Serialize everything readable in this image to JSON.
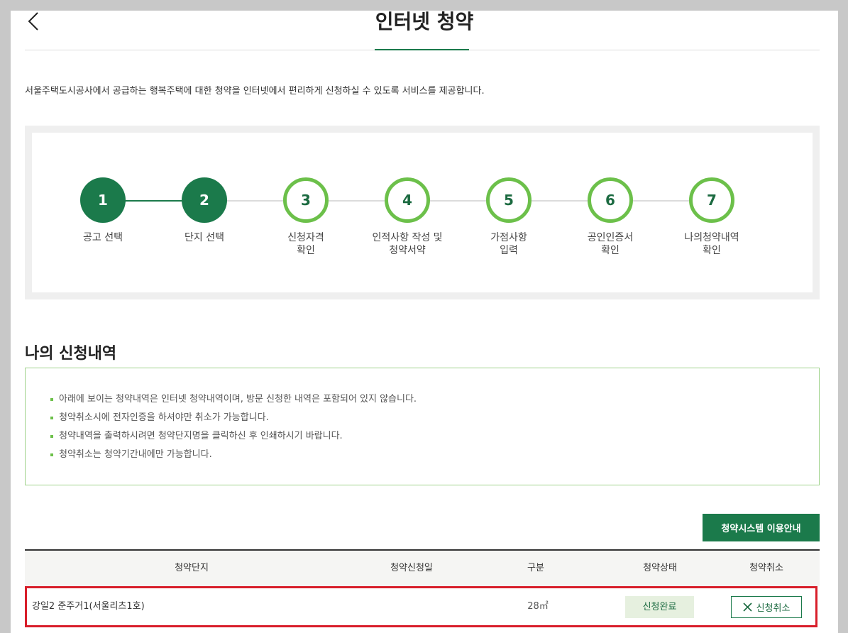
{
  "header": {
    "title": "인터넷 청약",
    "back_icon": "chevron-left-icon"
  },
  "intro_text": "서울주택도시공사에서 공급하는 행복주택에 대한 청약을 인터넷에서 편리하게 신청하실 수 있도록 서비스를 제공합니다.",
  "steps": [
    {
      "number": "1",
      "label": "공고 선택",
      "state": "done"
    },
    {
      "number": "2",
      "label": "단지 선택",
      "state": "done"
    },
    {
      "number": "3",
      "label": "신청자격\n확인",
      "state": "todo"
    },
    {
      "number": "4",
      "label": "인적사항 작성 및\n청약서약",
      "state": "todo"
    },
    {
      "number": "5",
      "label": "가점사항\n입력",
      "state": "todo"
    },
    {
      "number": "6",
      "label": "공인인증서\n확인",
      "state": "todo"
    },
    {
      "number": "7",
      "label": "나의청약내역\n확인",
      "state": "todo"
    }
  ],
  "section": {
    "title": "나의 신청내역",
    "notices": [
      "아래에 보이는 청약내역은 인터넷 청약내역이며, 방문 신청한 내역은 포함되어 있지 않습니다.",
      "청약취소시에 전자인증을 하셔야만 취소가 가능합니다.",
      "청약내역을 출력하시려면 청약단지명을 클릭하신 후 인쇄하시기 바랍니다.",
      "청약취소는 청약기간내에만 가능합니다."
    ],
    "guide_button": "청약시스템 이용안내"
  },
  "table": {
    "headers": [
      "청약단지",
      "청약신청일",
      "구분",
      "청약상태",
      "청약취소"
    ],
    "rows": [
      {
        "complex": "강일2 준주거1(서울리츠1호)",
        "date": "",
        "type": "28㎡",
        "status": "신청완료",
        "cancel_label": "신청취소",
        "cancel_icon": "close-icon"
      }
    ]
  },
  "colors": {
    "brand_green": "#1b7a4b",
    "light_green": "#6cc04a",
    "highlight_red": "#d81e2a"
  }
}
